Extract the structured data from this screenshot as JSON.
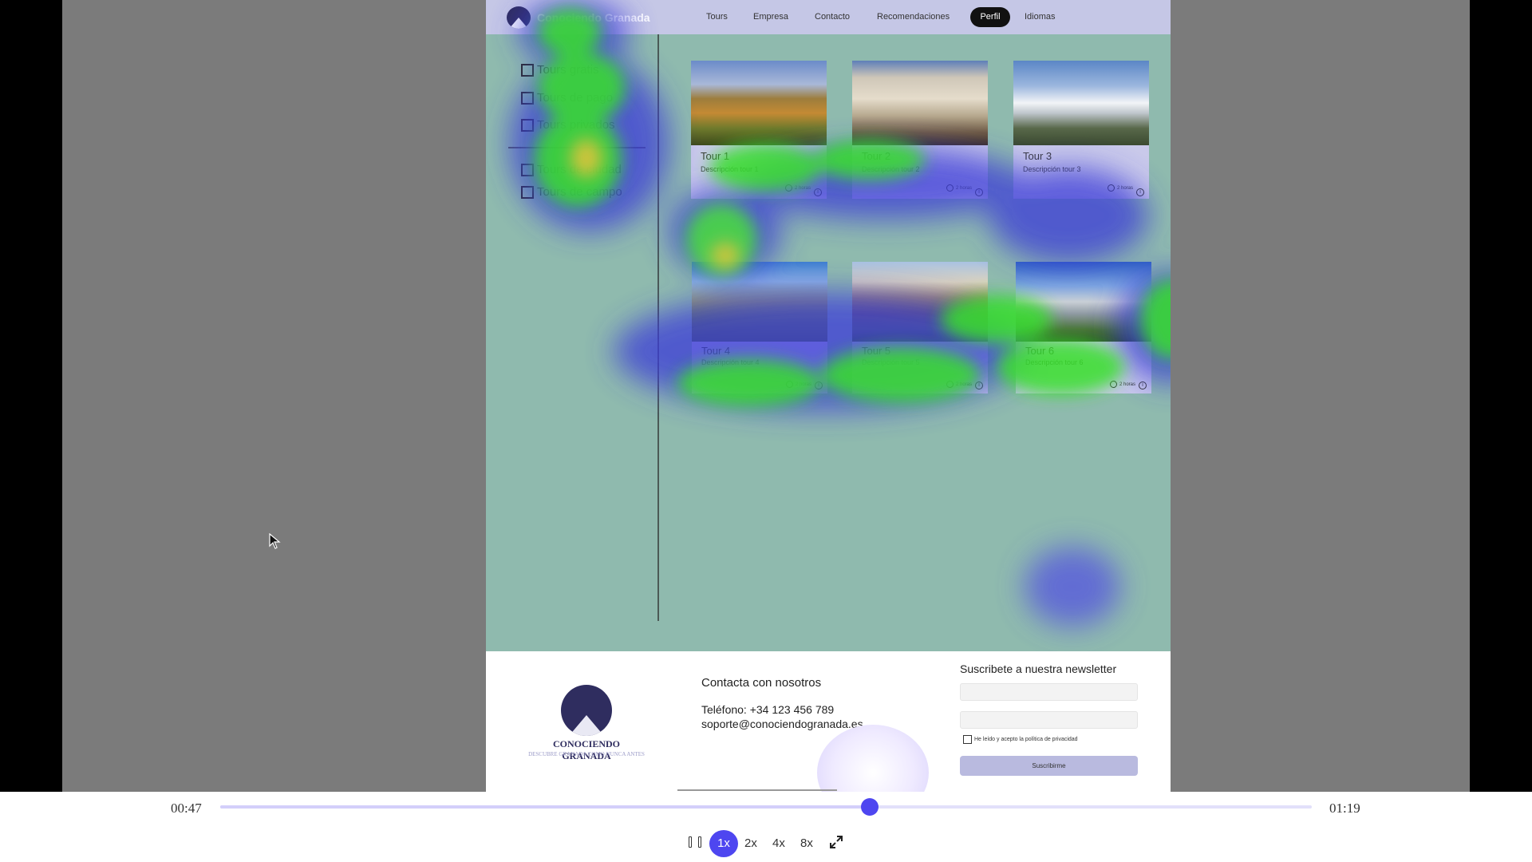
{
  "site": {
    "brand_name": "Conociendo Granada",
    "nav": {
      "tours": "Tours",
      "empresa": "Empresa",
      "contacto": "Contacto",
      "recomendaciones": "Recomendaciones",
      "perfil": "Perfil",
      "idiomas": "Idiomas"
    },
    "filters": [
      "Tours gratis",
      "Tours de pago",
      "Tours privados",
      "Tours de ciudad",
      "Tours de campo"
    ],
    "tours": [
      {
        "title": "Tour 1",
        "description": "Descripción tour 1",
        "duration": "2 horas",
        "info": "i"
      },
      {
        "title": "Tour 2",
        "description": "Descripción tour 2",
        "duration": "2 horas",
        "info": "i"
      },
      {
        "title": "Tour 3",
        "description": "Descripción tour 3",
        "duration": "2 horas",
        "info": "i"
      },
      {
        "title": "Tour 4",
        "description": "Descripción tour 4",
        "duration": "2 horas",
        "info": "i"
      },
      {
        "title": "Tour 5",
        "description": "Descripción tour 5",
        "duration": "2 horas",
        "info": "i"
      },
      {
        "title": "Tour 6",
        "description": "Descripción tour 6",
        "duration": "2 horas",
        "info": "i"
      }
    ],
    "footer": {
      "logo_name": "CONOCIENDO GRANADA",
      "logo_tagline": "DESCUBRE GRANADA COMO NUNCA ANTES",
      "contact_title": "Contacta con nosotros",
      "phone": "Teléfono: +34 123 456 789",
      "email": "soporte@conociendogranada.es",
      "newsletter_title": "Suscribete a nuestra newsletter",
      "privacy_label": "He leído y acepto la política de privacidad",
      "subscribe_label": "Suscribirme"
    }
  },
  "player": {
    "current_time": "00:47",
    "total_time": "01:19",
    "progress": 0.595,
    "speeds": [
      "1x",
      "2x",
      "4x",
      "8x"
    ],
    "active_speed": "1x",
    "pause_icon": "pause-icon",
    "fullscreen_icon": "expand-icon"
  },
  "colors": {
    "accent": "#4e46f0",
    "page_background": "#8fbaae",
    "nav_background": "#c5c7e6",
    "card_background": "#c9c9ea"
  }
}
